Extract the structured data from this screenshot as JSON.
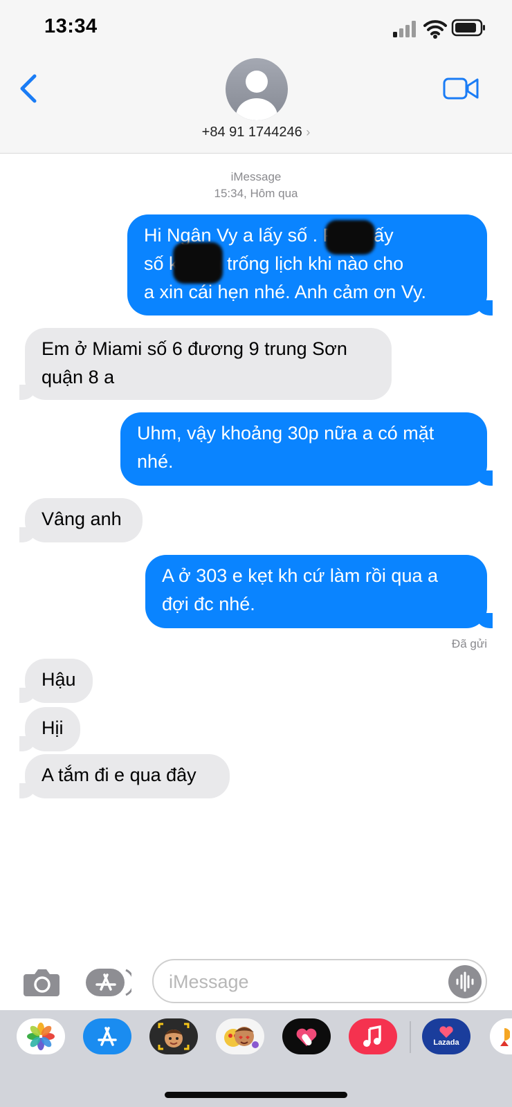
{
  "status_bar": {
    "time": "13:34"
  },
  "header": {
    "contact": "+84 91 1744246",
    "chevron": "›"
  },
  "conversation": {
    "service": "iMessage",
    "timestamp": "15:34, Hôm qua",
    "messages": [
      {
        "from": "me",
        "text": "Hi Ngân Vy a lấy số ... Pass lấy số ... Em trống lịch khi nào cho a xin cái hẹn nhé. Anh cảm ơn Vy.",
        "lines": [
          "Hi Ngân Vy a lấy số           . Pass lấy",
          "số k           . Em trống lịch khi nào cho",
          "a xin cái hẹn nhé. Anh cảm ơn Vy."
        ]
      },
      {
        "from": "them",
        "text": "Em ở Miami số 6 đương 9 trung Sơn quận 8 a",
        "lines": [
          "Em ở Miami số 6 đương 9 trung Sơn",
          "quận 8 a"
        ]
      },
      {
        "from": "me",
        "text": "Uhm, vậy khoảng 30p nữa a có mặt nhé.",
        "lines": [
          "Uhm, vậy khoảng 30p nữa a có mặt",
          "nhé."
        ]
      },
      {
        "from": "them",
        "text": "Vâng anh",
        "lines": [
          "Vâng anh"
        ]
      },
      {
        "from": "me",
        "text": "A ở 303 e kẹt kh cứ làm rồi qua a đợi đc nhé.",
        "lines": [
          "A ở 303 e kẹt kh cứ làm rồi qua a",
          "đợi đc nhé."
        ]
      },
      {
        "from": "them",
        "text": "Hậu",
        "lines": [
          "Hậu"
        ]
      },
      {
        "from": "them",
        "text": "Hịi",
        "lines": [
          "Hịi"
        ]
      },
      {
        "from": "them",
        "text": "A tắm đi e qua đây",
        "lines": [
          "A tắm đi e qua đây"
        ]
      }
    ],
    "delivered": "Đã gửi"
  },
  "compose": {
    "placeholder": "iMessage"
  },
  "app_drawer": {
    "apps": [
      "photos-icon",
      "app-store-icon",
      "memoji-icon",
      "animoji-icon",
      "digital-touch-icon",
      "music-icon",
      "lazada-icon",
      "partial-app-icon"
    ],
    "lazada_label": "Lazada"
  },
  "colors": {
    "outgoing": "#0a84ff",
    "incoming": "#e9e9eb",
    "accent": "#1a7cf5"
  }
}
